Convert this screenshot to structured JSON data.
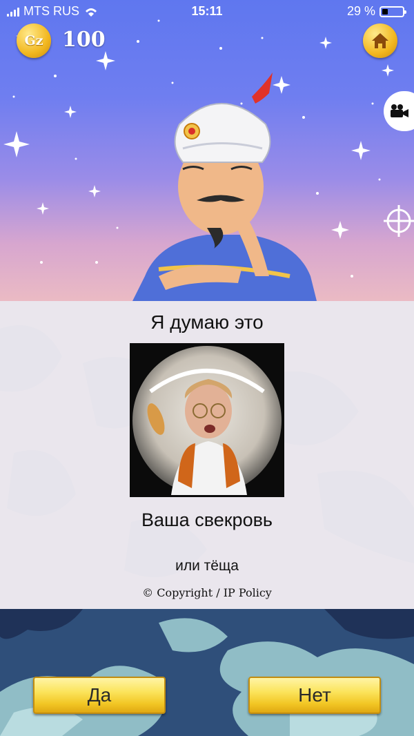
{
  "status_bar": {
    "carrier": "MTS RUS",
    "time": "15:11",
    "battery": "29 %"
  },
  "hud": {
    "coin_label": "Gz",
    "coin_count": "100"
  },
  "result": {
    "heading": "Я думаю это",
    "answer": "Ваша свекровь",
    "alternative": "или тёща",
    "copyright": "© Copyright / IP Policy"
  },
  "buttons": {
    "yes": "Да",
    "no": "Нет"
  },
  "icons": {
    "coin": "gz-coin-icon",
    "home": "home-icon",
    "video": "video-camera-icon",
    "target": "crosshair-icon"
  },
  "colors": {
    "sky_top": "#5f77ef",
    "sky_bottom": "#f3c3bf",
    "gold": "#f2c624",
    "panel": "#e8e6ee"
  }
}
